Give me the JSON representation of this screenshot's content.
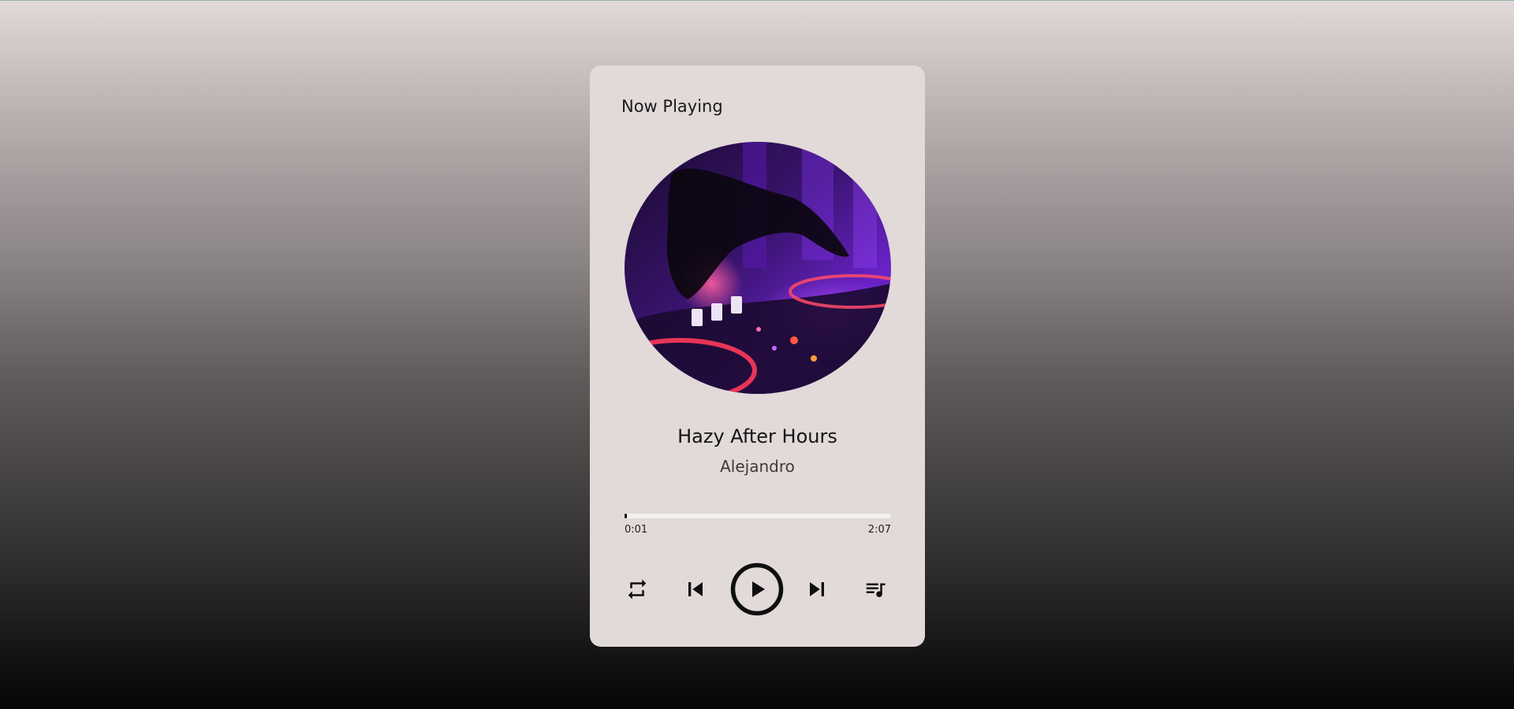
{
  "header": {
    "label": "Now Playing"
  },
  "track": {
    "title": "Hazy After Hours",
    "artist": "Alejandro",
    "progress_fraction": 0.008
  },
  "time": {
    "current": "0:01",
    "total": "2:07"
  },
  "controls": {
    "repeat_icon": "repeat-icon",
    "previous_icon": "skip-previous-icon",
    "play_icon": "play-circle-icon",
    "next_icon": "skip-next-icon",
    "playlist_icon": "queue-music-icon"
  },
  "colors": {
    "card_background": "#e2d9d9",
    "icon_color": "#0f0f0f",
    "progress_track": "#f4f1f1"
  }
}
